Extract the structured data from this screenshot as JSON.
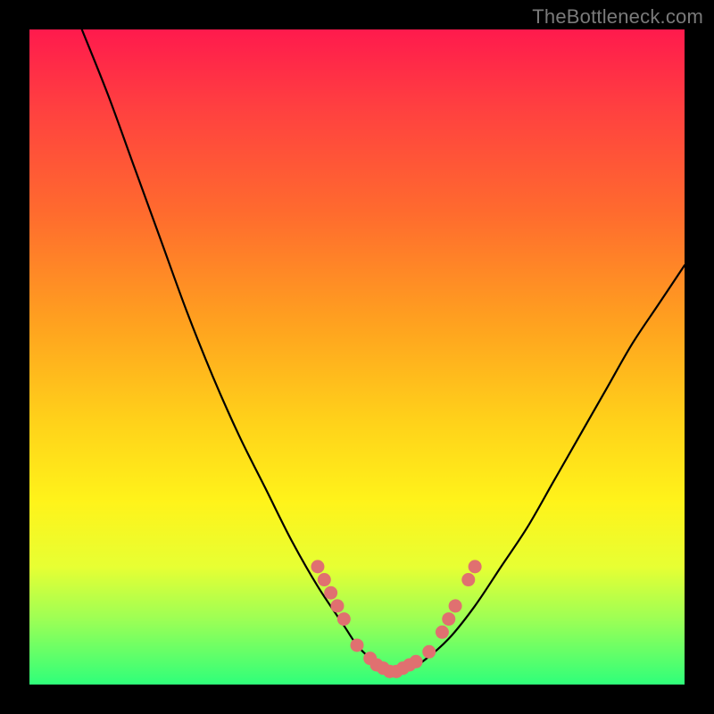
{
  "watermark": "TheBottleneck.com",
  "chart_data": {
    "type": "line",
    "title": "",
    "xlabel": "",
    "ylabel": "",
    "xlim": [
      0,
      100
    ],
    "ylim": [
      0,
      100
    ],
    "series": [
      {
        "name": "bottleneck-curve",
        "x": [
          8,
          12,
          16,
          20,
          24,
          28,
          32,
          36,
          40,
          44,
          48,
          50,
          52,
          54,
          56,
          58,
          60,
          64,
          68,
          72,
          76,
          80,
          84,
          88,
          92,
          96,
          100
        ],
        "y": [
          100,
          90,
          79,
          68,
          57,
          47,
          38,
          30,
          22,
          15,
          9,
          6,
          4,
          2.5,
          2,
          2.5,
          3.5,
          7,
          12,
          18,
          24,
          31,
          38,
          45,
          52,
          58,
          64
        ]
      }
    ],
    "highlight_points": {
      "name": "cluster-dots",
      "x": [
        44,
        45,
        46,
        47,
        48,
        50,
        52,
        53,
        54,
        55,
        56,
        57,
        58,
        59,
        61,
        63,
        64,
        65,
        67,
        68
      ],
      "y": [
        18,
        16,
        14,
        12,
        10,
        6,
        4,
        3,
        2.5,
        2,
        2,
        2.5,
        3,
        3.5,
        5,
        8,
        10,
        12,
        16,
        18
      ]
    },
    "background_gradient": {
      "top": "#ff1a4d",
      "bottom": "#2fff7a"
    }
  }
}
